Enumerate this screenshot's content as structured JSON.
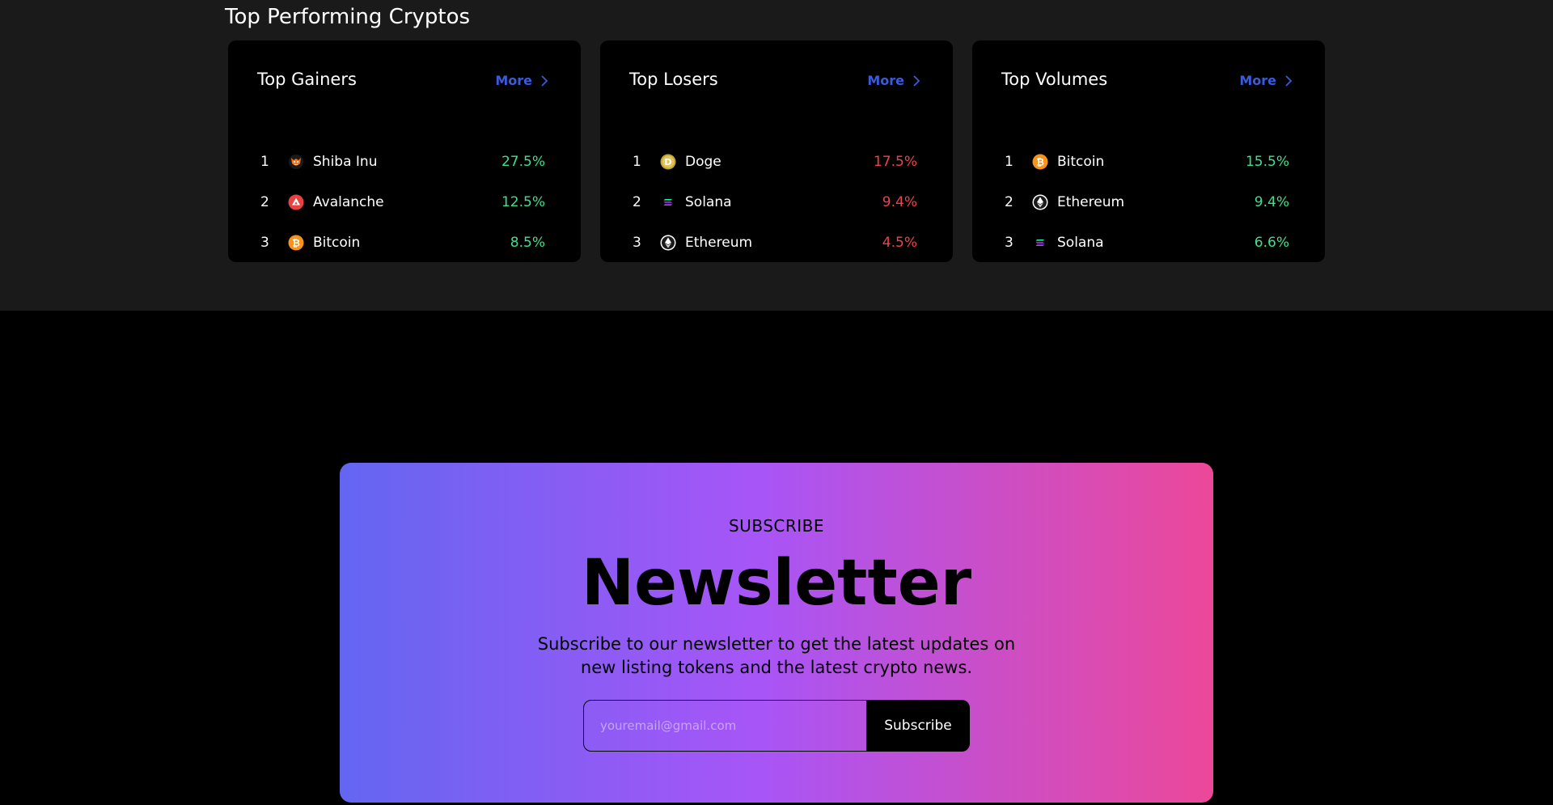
{
  "section": {
    "title": "Top Performing Cryptos"
  },
  "cards": [
    {
      "title": "Top Gainers",
      "more_label": "More",
      "items": [
        {
          "rank": "1",
          "name": "Shiba Inu",
          "percent": "27.5%",
          "trend": "up",
          "icon": "shiba-inu-icon"
        },
        {
          "rank": "2",
          "name": "Avalanche",
          "percent": "12.5%",
          "trend": "up",
          "icon": "avalanche-icon"
        },
        {
          "rank": "3",
          "name": "Bitcoin",
          "percent": "8.5%",
          "trend": "up",
          "icon": "bitcoin-icon"
        }
      ]
    },
    {
      "title": "Top Losers",
      "more_label": "More",
      "items": [
        {
          "rank": "1",
          "name": "Doge",
          "percent": "17.5%",
          "trend": "down",
          "icon": "doge-icon"
        },
        {
          "rank": "2",
          "name": "Solana",
          "percent": "9.4%",
          "trend": "down",
          "icon": "solana-icon"
        },
        {
          "rank": "3",
          "name": "Ethereum",
          "percent": "4.5%",
          "trend": "down",
          "icon": "ethereum-icon"
        }
      ]
    },
    {
      "title": "Top Volumes",
      "more_label": "More",
      "items": [
        {
          "rank": "1",
          "name": "Bitcoin",
          "percent": "15.5%",
          "trend": "up",
          "icon": "bitcoin-icon"
        },
        {
          "rank": "2",
          "name": "Ethereum",
          "percent": "9.4%",
          "trend": "up",
          "icon": "ethereum-icon"
        },
        {
          "rank": "3",
          "name": "Solana",
          "percent": "6.6%",
          "trend": "up",
          "icon": "solana-icon"
        }
      ]
    }
  ],
  "newsletter": {
    "kicker": "SUBSCRIBE",
    "title": "Newsletter",
    "description": "Subscribe to our newsletter to get the latest updates on new listing tokens and the latest crypto news.",
    "email_placeholder": "youremail@gmail.com",
    "email_value": "",
    "button_label": "Subscribe"
  },
  "colors": {
    "positive": "#3ee08f",
    "negative": "#f0424b",
    "link": "#3b5bdb",
    "gradient_start": "#6366f1",
    "gradient_mid": "#a855f7",
    "gradient_end": "#ec4899"
  }
}
